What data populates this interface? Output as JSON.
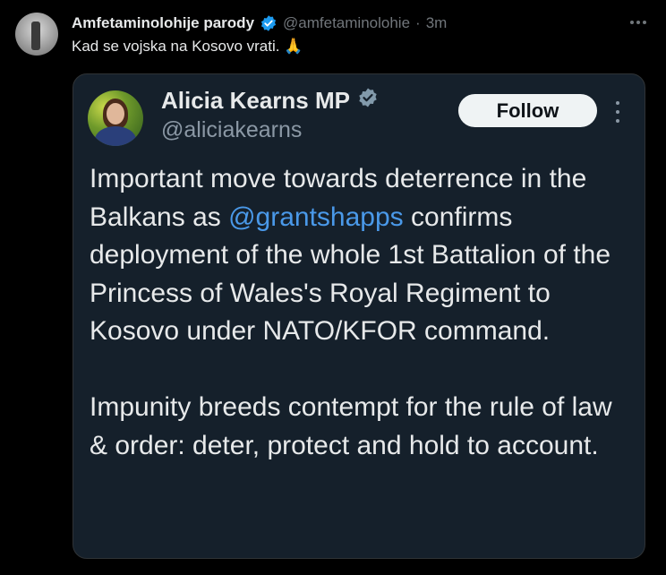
{
  "tweet": {
    "author_name": "Amfetaminolohije parody",
    "handle": "@amfetaminolohie",
    "separator": "·",
    "time": "3m",
    "text": "Kad se vojska na Kosovo vrati. 🙏"
  },
  "quoted": {
    "name": "Alicia Kearns MP",
    "handle": "@aliciakearns",
    "follow_label": "Follow",
    "p1_before": "Important move towards deterrence in the Balkans as ",
    "mention": "@grantshapps",
    "p1_after": " confirms deployment of the whole 1st Battalion of the Princess of Wales's Royal Regiment to Kosovo under NATO/KFOR command.",
    "p2": "Impunity breeds contempt for the rule of law & order: deter, protect and hold to account."
  },
  "icons": {
    "verified": "verified-badge-icon",
    "gray_verified": "gray-verified-badge-icon",
    "more": "more-horizontal-icon"
  },
  "colors": {
    "background": "#000000",
    "card_background": "#15202b",
    "mention": "#4a99e9",
    "verified_blue": "#1d9bf0",
    "verified_gray": "#829aab"
  }
}
